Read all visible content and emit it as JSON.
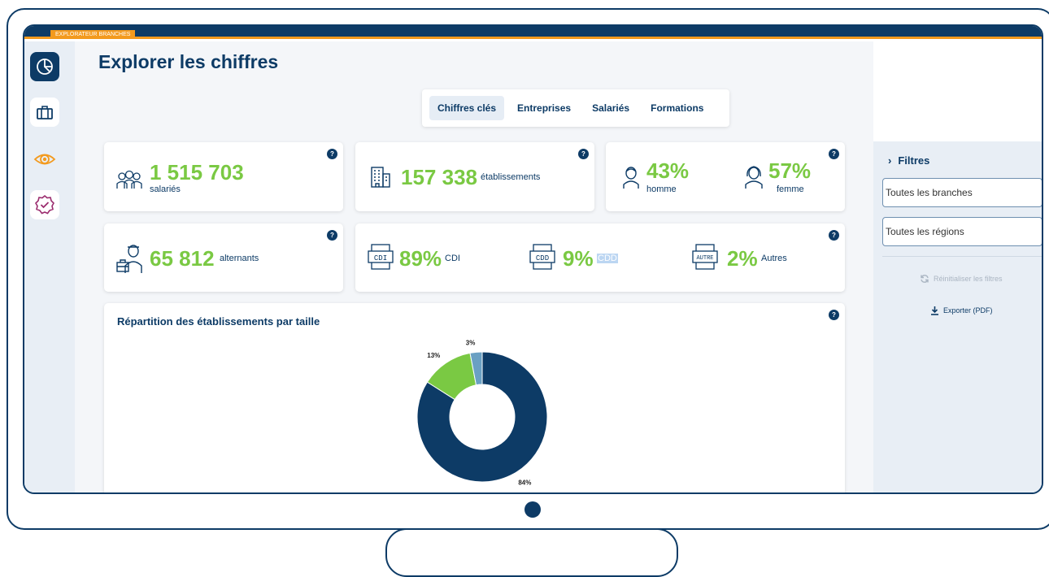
{
  "topbar": {
    "tag": "EXPLORATEUR BRANCHES"
  },
  "colors": {
    "navy": "#0d3b66",
    "green": "#7ac943",
    "orange": "#f39a1e",
    "light_blue": "#6aa0c3"
  },
  "sidebar": {
    "items": [
      {
        "icon": "pie-chart-icon",
        "active": true
      },
      {
        "icon": "briefcase-icon",
        "active": false
      },
      {
        "icon": "eye-icon",
        "active": false
      },
      {
        "icon": "badge-check-icon",
        "active": false
      }
    ]
  },
  "page": {
    "title": "Explorer les chiffres"
  },
  "tabs": [
    {
      "label": "Chiffres clés",
      "active": true
    },
    {
      "label": "Entreprises",
      "active": false
    },
    {
      "label": "Salariés",
      "active": false
    },
    {
      "label": "Formations",
      "active": false
    }
  ],
  "help_label": "?",
  "stats": {
    "salaries": {
      "value": "1 515 703",
      "label": "salariés"
    },
    "etablissements": {
      "value": "157 338",
      "label": "établissements"
    },
    "homme": {
      "value": "43%",
      "label": "homme"
    },
    "femme": {
      "value": "57%",
      "label": "femme"
    },
    "alternants": {
      "value": "65 812",
      "label": "alternants"
    },
    "cdi": {
      "value": "89%",
      "label": "CDI",
      "icon_text": "CDI"
    },
    "cdd": {
      "value": "9%",
      "label": "CDD",
      "icon_text": "CDD"
    },
    "autres": {
      "value": "2%",
      "label": "Autres",
      "icon_text": "AUTRE"
    }
  },
  "chart_card": {
    "title": "Répartition des établissements par taille"
  },
  "chart_data": {
    "type": "pie",
    "title": "Répartition des établissements par taille",
    "donut": true,
    "slices": [
      {
        "value": 84,
        "label": "84%",
        "color": "#0d3b66"
      },
      {
        "value": 13,
        "label": "13%",
        "color": "#7ac943"
      },
      {
        "value": 3,
        "label": "3%",
        "color": "#6aa0c3"
      }
    ]
  },
  "filters": {
    "title": "Filtres",
    "branches": "Toutes les branches",
    "regions": "Toutes les régions",
    "reset": "Réinitialiser les filtres",
    "export": "Exporter (PDF)"
  }
}
